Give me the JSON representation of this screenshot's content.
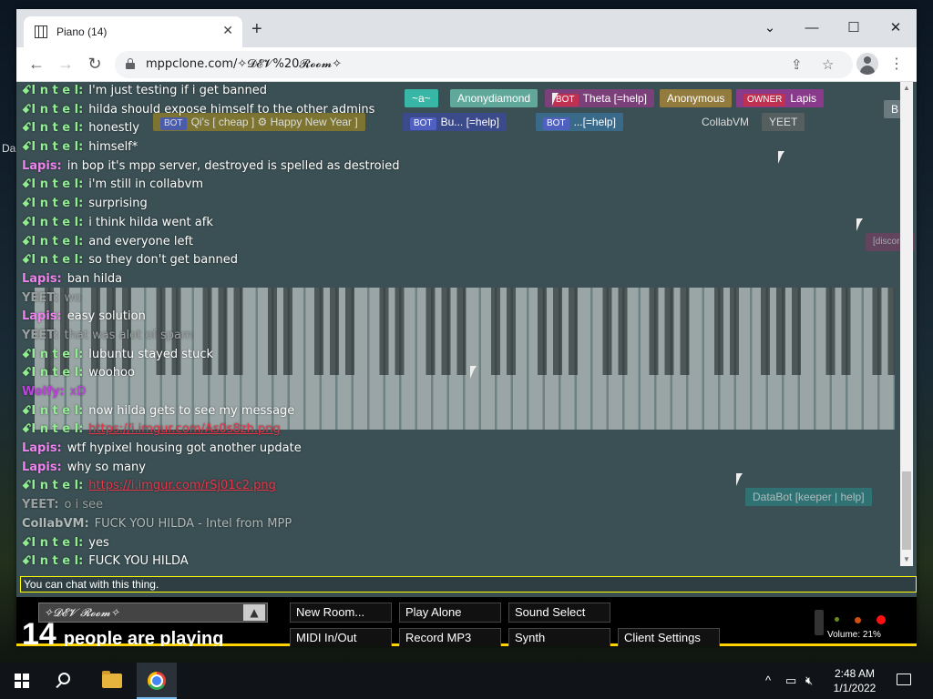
{
  "desktop": {
    "label": "Da"
  },
  "browser": {
    "tab_title": "Piano (14)",
    "tab_close": "✕",
    "new_tab": "+",
    "url": "mppclone.com/✧𝓓𝓔𝓥%20𝓡𝓸𝓸𝓶✧",
    "win_controls": {
      "dropdown": "⌄",
      "minimize": "—",
      "maximize": "☐",
      "close": "✕"
    },
    "nav": {
      "back": "←",
      "forward": "→",
      "reload": "↻"
    }
  },
  "participants": [
    {
      "name": "~a~",
      "color": "#38b6a6"
    },
    {
      "name": "Anonydiamond",
      "color": "#5fa89a"
    },
    {
      "tag": "BOT",
      "name": "Theta [=help]",
      "color": "#7b3f7a"
    },
    {
      "name": "Anonymous",
      "color": "#927b3c"
    },
    {
      "tag": "OWNER",
      "name": "Lapis",
      "color": "#8a3a8a"
    },
    {
      "tag": "BOT",
      "name": "Qi's [ cheap ] ⚙ Happy New Year ]",
      "color": "#8e7d2a"
    },
    {
      "tag": "BOT",
      "name": "Bu... [=help]",
      "color": "#3a4a8a"
    },
    {
      "tag": "BOT",
      "name": "...[=help]",
      "color": "#3a6a8a"
    },
    {
      "name": "CollabVM",
      "color": "#3b5054"
    },
    {
      "name": "YEET",
      "color": "#555f5f"
    },
    {
      "name": "B",
      "color": "#6a7a7f"
    },
    {
      "name": "DataBot [keeper | help]",
      "color": "#2a8a8a"
    },
    {
      "name": "[discord]",
      "color": "#8a3a6a"
    }
  ],
  "chat": [
    {
      "who": "ꗃI n t e l:",
      "color": "#90ee90",
      "text": "I'm just testing if i get banned"
    },
    {
      "who": "ꗃI n t e l:",
      "color": "#90ee90",
      "text": "hilda should expose himself to the other admins"
    },
    {
      "who": "ꗃI n t e l:",
      "color": "#90ee90",
      "text": "honestly"
    },
    {
      "who": "ꗃI n t e l:",
      "color": "#90ee90",
      "text": "himself*"
    },
    {
      "who": "Lapis:",
      "color": "#ee82ee",
      "text": "in bop it's mpp server, destroyed is spelled as destroied"
    },
    {
      "who": "ꗃI n t e l:",
      "color": "#90ee90",
      "text": "i'm still in collabvm"
    },
    {
      "who": "ꗃI n t e l:",
      "color": "#90ee90",
      "text": "surprising"
    },
    {
      "who": "ꗃI n t e l:",
      "color": "#90ee90",
      "text": "i think hilda went afk"
    },
    {
      "who": "ꗃI n t e l:",
      "color": "#90ee90",
      "text": "and everyone left"
    },
    {
      "who": "ꗃI n t e l:",
      "color": "#90ee90",
      "text": "so they don't get banned"
    },
    {
      "who": "Lapis:",
      "color": "#ee82ee",
      "text": "ban hilda"
    },
    {
      "who": "YEET:",
      "color": "#9aa0a0",
      "text": "wo"
    },
    {
      "who": "Lapis:",
      "color": "#ee82ee",
      "text": "easy solution"
    },
    {
      "who": "YEET:",
      "color": "#9aa0a0",
      "text": "that was alot of spam"
    },
    {
      "who": "ꗃI n t e l:",
      "color": "#90ee90",
      "text": "lubuntu stayed stuck"
    },
    {
      "who": "ꗃI n t e l:",
      "color": "#90ee90",
      "text": "woohoo"
    },
    {
      "who": "Wolfy:",
      "color": "#c040e0",
      "text": "xD"
    },
    {
      "who": "ꗃI n t e l:",
      "color": "#90ee90",
      "text": "now hilda gets to see my message"
    },
    {
      "who": "ꗃI n t e l:",
      "color": "#90ee90",
      "link": "https://i.imgur.com/As0s8zh.png"
    },
    {
      "who": "Lapis:",
      "color": "#ee82ee",
      "text": "wtf hypixel housing got another update"
    },
    {
      "who": "Lapis:",
      "color": "#ee82ee",
      "text": "why so many"
    },
    {
      "who": "ꗃI n t e l:",
      "color": "#90ee90",
      "link": "https://i.imgur.com/rSj01c2.png"
    },
    {
      "who": "YEET:",
      "color": "#9aa0a0",
      "text": "o i see"
    },
    {
      "who": "CollabVM:",
      "color": "#b0b8b8",
      "text": "FUCK YOU HILDA - Intel from MPP"
    },
    {
      "who": "ꗃI n t e l:",
      "color": "#90ee90",
      "text": "yes"
    },
    {
      "who": "ꗃI n t e l:",
      "color": "#90ee90",
      "text": "FUCK YOU HILDA"
    }
  ],
  "chat_input": {
    "placeholder": "You can chat with this thing."
  },
  "bottombar": {
    "room_name": "✧𝓓𝓔𝓥 𝓡𝓸𝓸𝓶✧",
    "room_arrow": "▲",
    "player_count": "14",
    "player_label": "people are playing",
    "buttons": {
      "new_room": "New Room...",
      "play_alone": "Play Alone",
      "sound_select": "Sound Select",
      "midi": "MIDI In/Out",
      "record": "Record MP3",
      "synth": "Synth",
      "client_settings": "Client Settings"
    },
    "volume_label": "Volume: 21%"
  },
  "taskbar": {
    "time": "2:48 AM",
    "date": "1/1/2022",
    "tray_up": "^"
  },
  "colors": {
    "accent": "#ffd300",
    "page_bg": "#3b5054"
  }
}
